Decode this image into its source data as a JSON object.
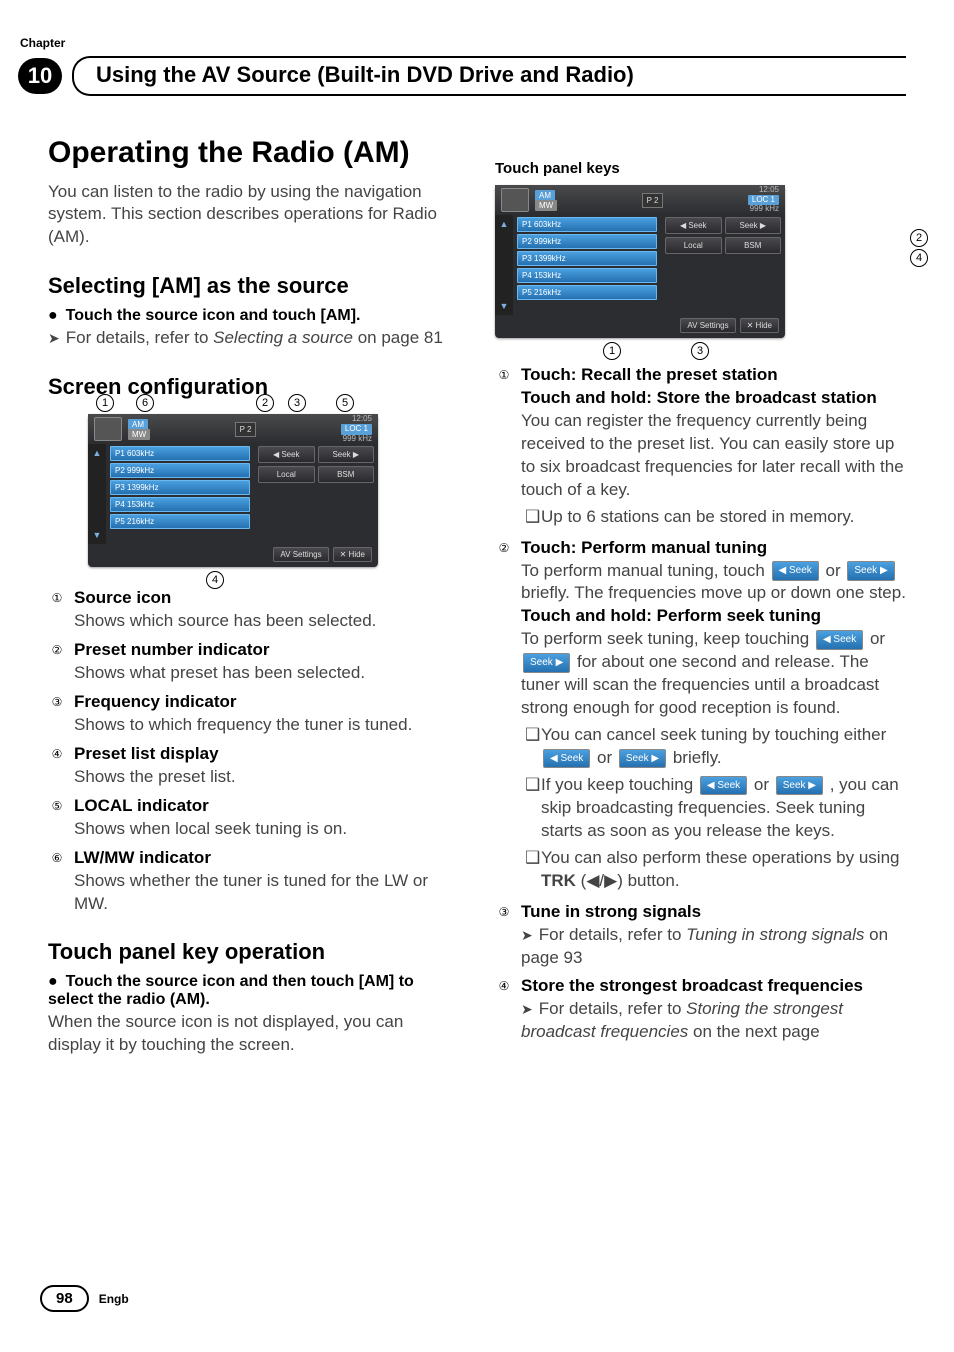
{
  "chapter_label": "Chapter",
  "chapter_number": "10",
  "section_title": "Using the AV Source (Built-in DVD Drive and Radio)",
  "main_heading": "Operating the Radio (AM)",
  "intro_text": "You can listen to the radio by using the navigation system. This section describes operations for Radio (AM).",
  "subhead_selecting": "Selecting [AM] as the source",
  "selecting_bullet": "Touch the source icon and touch [AM].",
  "selecting_ref_pre": "For details, refer to ",
  "selecting_ref_link": "Selecting a source",
  "selecting_ref_post": " on page 81",
  "subhead_screen": "Screen configuration",
  "screen_callouts": [
    "1",
    "6",
    "2",
    "3",
    "5",
    "4"
  ],
  "shot": {
    "band": "AM",
    "mw": "MW",
    "time": "12:05",
    "loc": "LOC 1",
    "p2": "P 2",
    "freq": "999 kHz",
    "presets": [
      "P1   603kHz",
      "P2   999kHz",
      "P3  1399kHz",
      "P4   153kHz",
      "P5   216kHz"
    ],
    "seek_l": "◀   Seek",
    "seek_r": "Seek   ▶",
    "local": "Local",
    "bsm": "BSM",
    "av": "AV Settings",
    "hide": "✕ Hide"
  },
  "list": [
    {
      "num": "1",
      "title": "Source icon",
      "desc": "Shows which source has been selected."
    },
    {
      "num": "2",
      "title": "Preset number indicator",
      "desc": "Shows what preset has been selected."
    },
    {
      "num": "3",
      "title": "Frequency indicator",
      "desc": "Shows to which frequency the tuner is tuned."
    },
    {
      "num": "4",
      "title": "Preset list display",
      "desc": "Shows the preset list."
    },
    {
      "num": "5",
      "title": "LOCAL indicator",
      "desc": "Shows when local seek tuning is on."
    },
    {
      "num": "6",
      "title": "LW/MW indicator",
      "desc": "Shows whether the tuner is tuned for the LW or MW."
    }
  ],
  "subhead_touch": "Touch panel key operation",
  "touch_bullet": "Touch the source icon and then touch [AM] to select the radio (AM).",
  "touch_text": "When the source icon is not displayed, you can display it by touching the screen.",
  "right_heading": "Touch panel keys",
  "r_callouts": [
    "1",
    "2",
    "3",
    "4"
  ],
  "r1_title": "Touch: Recall the preset station\nTouch and hold: Store the broadcast station",
  "r1_desc": "You can register the frequency currently being received to the preset list. You can easily store up to six broadcast frequencies for later recall with the touch of a key.",
  "r1_note": "Up to 6 stations can be stored in memory.",
  "r2_title": "Touch: Perform manual tuning",
  "r2_desc_a": "To perform manual tuning, touch ",
  "r2_desc_b": " or ",
  "r2_desc_c": " briefly. The frequencies move up or down one step.",
  "r2_sub_title": "Touch and hold: Perform seek tuning",
  "r2_sub_a": "To perform seek tuning, keep touching ",
  "r2_sub_b": " or ",
  "r2_sub_c": " for about one second and release. The tuner will scan the frequencies until a broadcast strong enough for good reception is found.",
  "r2_note1_a": "You can cancel seek tuning by touching either ",
  "r2_note1_b": " or ",
  "r2_note1_c": " briefly.",
  "r2_note2_a": "If you keep touching ",
  "r2_note2_b": " or ",
  "r2_note2_c": ", you can skip broadcasting frequencies. Seek tuning starts as soon as you release the keys.",
  "r2_note3_a": "You can also perform these operations by using ",
  "r2_note3_b": "TRK",
  "r2_note3_c": " (◀/▶) button.",
  "r3_title": "Tune in strong signals",
  "r3_ref_a": "For details, refer to ",
  "r3_ref_link": "Tuning in strong signals",
  "r3_ref_b": " on page 93",
  "r4_title": "Store the strongest broadcast frequencies",
  "r4_ref_a": "For details, refer to ",
  "r4_ref_link": "Storing the strongest broadcast frequencies",
  "r4_ref_b": " on the next page",
  "footer": {
    "page": "98",
    "lang": "Engb"
  },
  "seek_pill_l": "◀ Seek",
  "seek_pill_r": "Seek ▶"
}
